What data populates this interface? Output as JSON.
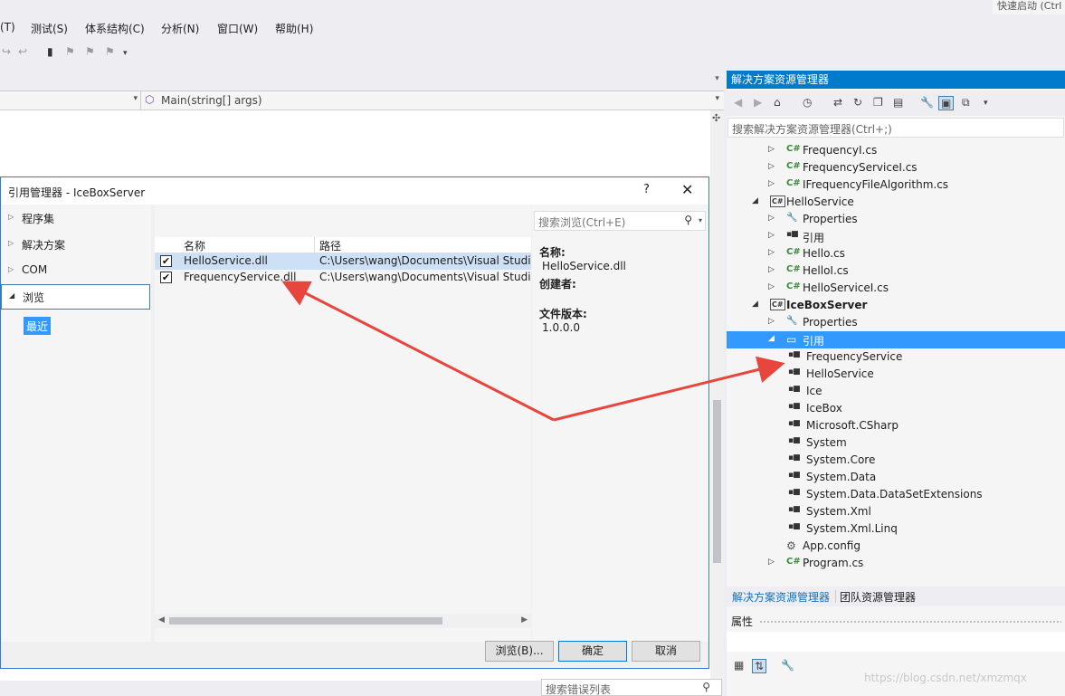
{
  "quick_launch": "快速启动 (Ctrl",
  "menu": [
    "(T)",
    "测试(S)",
    "体系结构(C)",
    "分析(N)",
    "窗口(W)",
    "帮助(H)"
  ],
  "editor": {
    "nav_method": "Main(string[] args)"
  },
  "error_list": {
    "search_placeholder": "搜索错误列表"
  },
  "dialog": {
    "title": "引用管理器 - IceBoxServer",
    "help": "?",
    "close": "✕",
    "categories": [
      {
        "label": "程序集",
        "expanded": false
      },
      {
        "label": "解决方案",
        "expanded": false
      },
      {
        "label": "COM",
        "expanded": false
      },
      {
        "label": "浏览",
        "expanded": true
      }
    ],
    "recent_label": "最近",
    "columns": {
      "name": "名称",
      "path": "路径"
    },
    "rows": [
      {
        "checked": true,
        "name": "HelloService.dll",
        "path": "C:\\Users\\wang\\Documents\\Visual Studio"
      },
      {
        "checked": true,
        "name": "FrequencyService.dll",
        "path": "C:\\Users\\wang\\Documents\\Visual Studio"
      }
    ],
    "search_placeholder": "搜索浏览(Ctrl+E)",
    "info": {
      "name_label": "名称:",
      "name_value": "HelloService.dll",
      "creator_label": "创建者:",
      "version_label": "文件版本:",
      "version_value": "1.0.0.0"
    },
    "buttons": {
      "browse": "浏览(B)...",
      "ok": "确定",
      "cancel": "取消"
    }
  },
  "solution_explorer": {
    "title": "解决方案资源管理器",
    "search_placeholder": "搜索解决方案资源管理器(Ctrl+;)",
    "tree": [
      {
        "label": "FrequencyI.cs",
        "type": "cs"
      },
      {
        "label": "FrequencyServiceI.cs",
        "type": "cs"
      },
      {
        "label": "IFrequencyFileAlgorithm.cs",
        "type": "cs"
      },
      {
        "label": "HelloService",
        "type": "project"
      },
      {
        "label": "Properties",
        "type": "props"
      },
      {
        "label": "引用",
        "type": "refs"
      },
      {
        "label": "Hello.cs",
        "type": "cs"
      },
      {
        "label": "HelloI.cs",
        "type": "cs"
      },
      {
        "label": "HelloServiceI.cs",
        "type": "cs"
      },
      {
        "label": "IceBoxServer",
        "type": "project"
      },
      {
        "label": "Properties",
        "type": "props"
      },
      {
        "label": "引用",
        "type": "folder"
      },
      {
        "label": "FrequencyService",
        "type": "ref"
      },
      {
        "label": "HelloService",
        "type": "ref"
      },
      {
        "label": "Ice",
        "type": "ref"
      },
      {
        "label": "IceBox",
        "type": "ref"
      },
      {
        "label": "Microsoft.CSharp",
        "type": "ref"
      },
      {
        "label": "System",
        "type": "ref"
      },
      {
        "label": "System.Core",
        "type": "ref"
      },
      {
        "label": "System.Data",
        "type": "ref"
      },
      {
        "label": "System.Data.DataSetExtensions",
        "type": "ref"
      },
      {
        "label": "System.Xml",
        "type": "ref"
      },
      {
        "label": "System.Xml.Linq",
        "type": "ref"
      },
      {
        "label": "App.config",
        "type": "config"
      },
      {
        "label": "Program.cs",
        "type": "cs"
      }
    ],
    "tabs": [
      "解决方案资源管理器",
      "团队资源管理器"
    ]
  },
  "properties": {
    "title": "属性",
    "watermark": "https://blog.csdn.net/xmzmqx"
  },
  "colors": {
    "accent": "#007acc",
    "selection": "#3399ff",
    "arrow": "#e8453c"
  }
}
